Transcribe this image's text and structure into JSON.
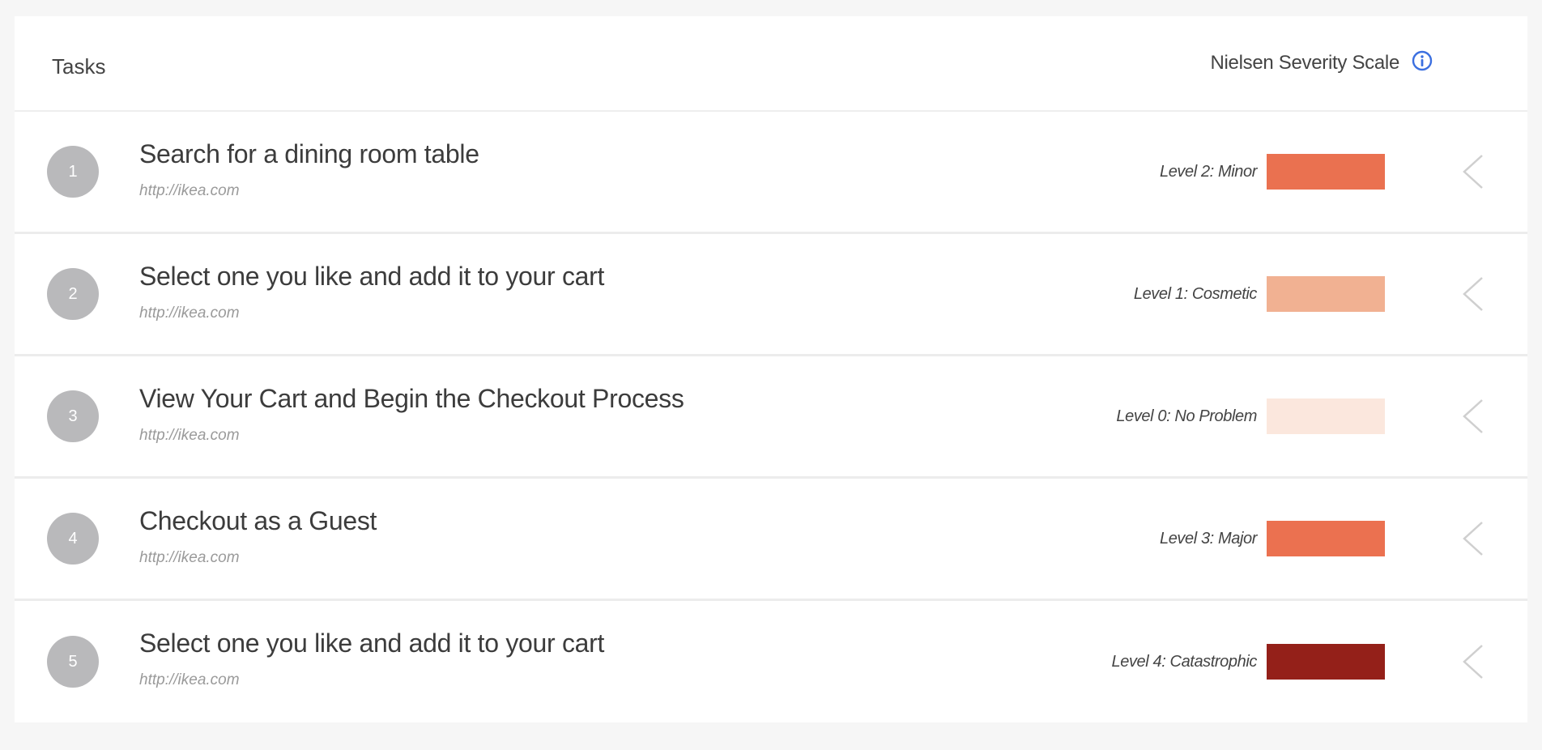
{
  "header": {
    "title": "Tasks",
    "scale_label": "Nielsen Severity Scale",
    "info_icon": "info-circle-icon"
  },
  "colors": {
    "info_blue": "#3b6fe0",
    "badge_gray": "#b9b9bb"
  },
  "tasks": [
    {
      "number": "1",
      "title": "Search for a dining room table",
      "url": "http://ikea.com",
      "level": "Level 2: Minor",
      "severity": 2,
      "color": "#ea7150"
    },
    {
      "number": "2",
      "title": "Select one you like and add it to your cart",
      "url": "http://ikea.com",
      "level": "Level 1: Cosmetic",
      "severity": 1,
      "color": "#f1b192"
    },
    {
      "number": "3",
      "title": "View Your Cart and Begin the Checkout Process",
      "url": "http://ikea.com",
      "level": "Level 0: No Problem",
      "severity": 0,
      "color": "#fbe7dd"
    },
    {
      "number": "4",
      "title": "Checkout as a Guest",
      "url": "http://ikea.com",
      "level": "Level 3: Major",
      "severity": 3,
      "color": "#eb7150"
    },
    {
      "number": "5",
      "title": "Select one you like and add it to your cart",
      "url": "http://ikea.com",
      "level": "Level 4: Catastrophic",
      "severity": 4,
      "color": "#942019"
    }
  ],
  "row_icon": "chevron-left-icon"
}
